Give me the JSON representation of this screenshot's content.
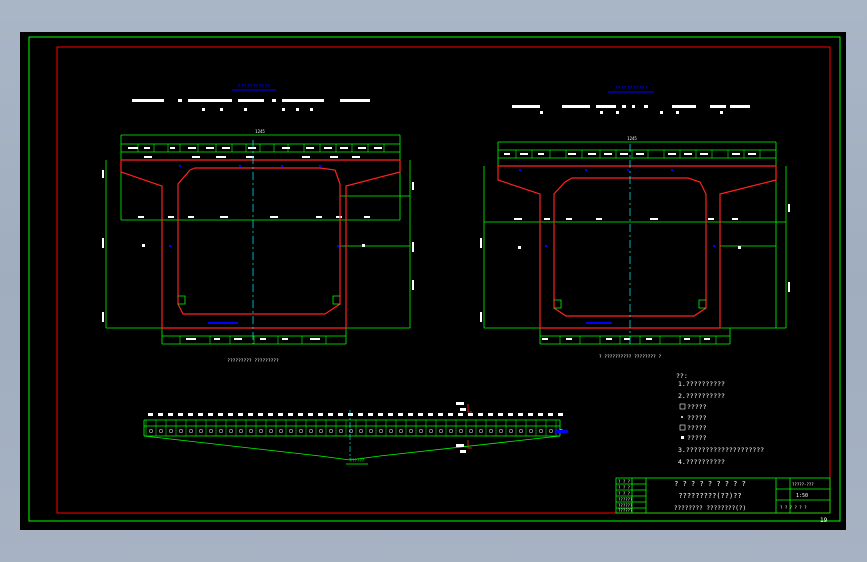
{
  "drawing": {
    "background": "#000000",
    "colors": {
      "frame": "#00ff00",
      "border": "#ff0000",
      "section": "#ff2020",
      "dim": "#00ff00",
      "axis": "#00ffff",
      "mark": "#0000ff",
      "text": "#ffffff"
    },
    "left_section": {
      "title": "???????????",
      "top_dim": "1245",
      "caption": "?????????  ?????????"
    },
    "right_section": {
      "title": "???????????",
      "top_dim": "1245",
      "caption": "? ??????????  ???????? ?"
    },
    "profile": {
      "label": "??????"
    },
    "notes": {
      "heading": "??:",
      "items": [
        "1.??????????",
        "2.??????????",
        "?????",
        "?????",
        "?????",
        "?????",
        "3.????????????????????",
        "4.??????????"
      ]
    },
    "title_block": {
      "project": "? ? ? ? ? ? ? ? ?",
      "drawing_name": "?????????(??)??",
      "drawing_subname": "???????? ????????(?)",
      "drawing_no": "?????-???",
      "scale": "1:50",
      "sheet": "? ? ?  ? ? ?",
      "left_rows": [
        "? ? ?",
        "? ? ?",
        "? ? ?",
        "??????",
        "??????",
        "??????"
      ],
      "page_number": "19"
    }
  }
}
